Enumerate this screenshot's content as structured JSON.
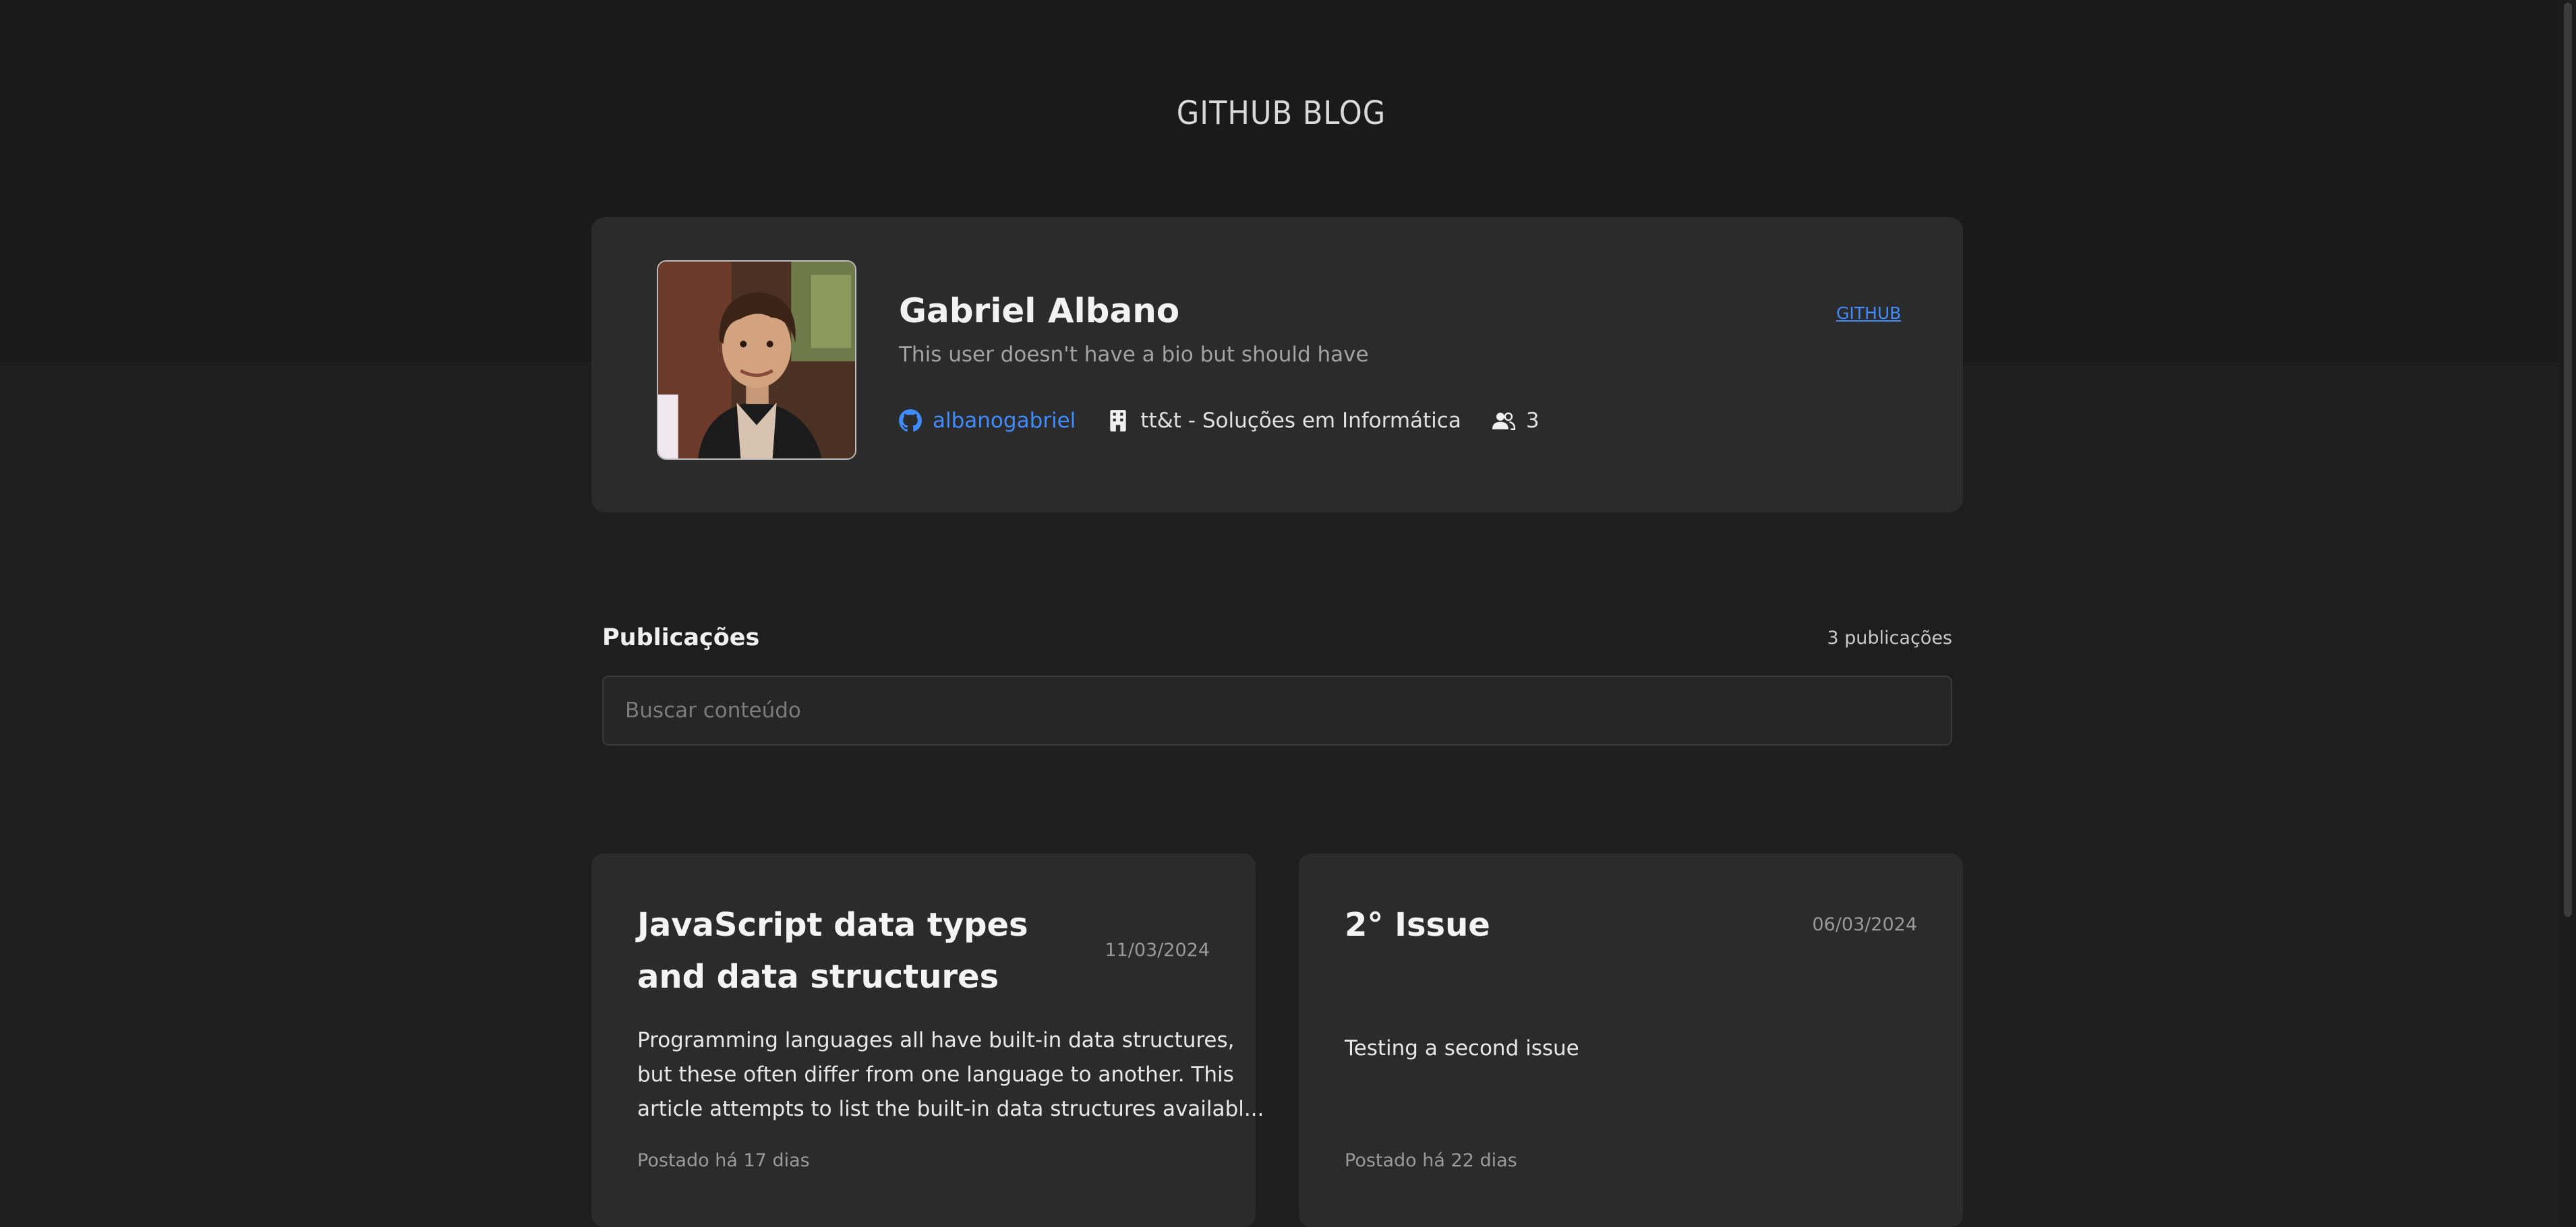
{
  "header": {
    "title": "GITHUB BLOG"
  },
  "profile": {
    "name": "Gabriel Albano",
    "bio": "This user doesn't have a bio but should have",
    "github_link": "GITHUB",
    "login": "albanogabriel",
    "company": "tt&t - Soluções em Informática",
    "followers": "3"
  },
  "publications": {
    "title": "Publicações",
    "count": "3 publicações",
    "search_placeholder": "Buscar conteúdo"
  },
  "posts": [
    {
      "title": "JavaScript data types and data structures",
      "date": "11/03/2024",
      "body_lines": [
        "Programming languages all have built-in data structures,",
        "but these often differ from one language to another. This",
        "article attempts to list the built-in data structures availabl..."
      ],
      "footer": "Postado há 17 dias"
    },
    {
      "title": "2° Issue",
      "date": "06/03/2024",
      "body_lines": [
        "Testing a second issue"
      ],
      "footer": "Postado há 22 dias"
    }
  ],
  "icons": {
    "github": "github-icon",
    "company": "building-icon",
    "followers": "users-icon"
  },
  "colors": {
    "accent": "#3f8cff",
    "background": "#1e1e1e",
    "header_background": "#1a1a1a",
    "card": "#2b2b2b"
  }
}
